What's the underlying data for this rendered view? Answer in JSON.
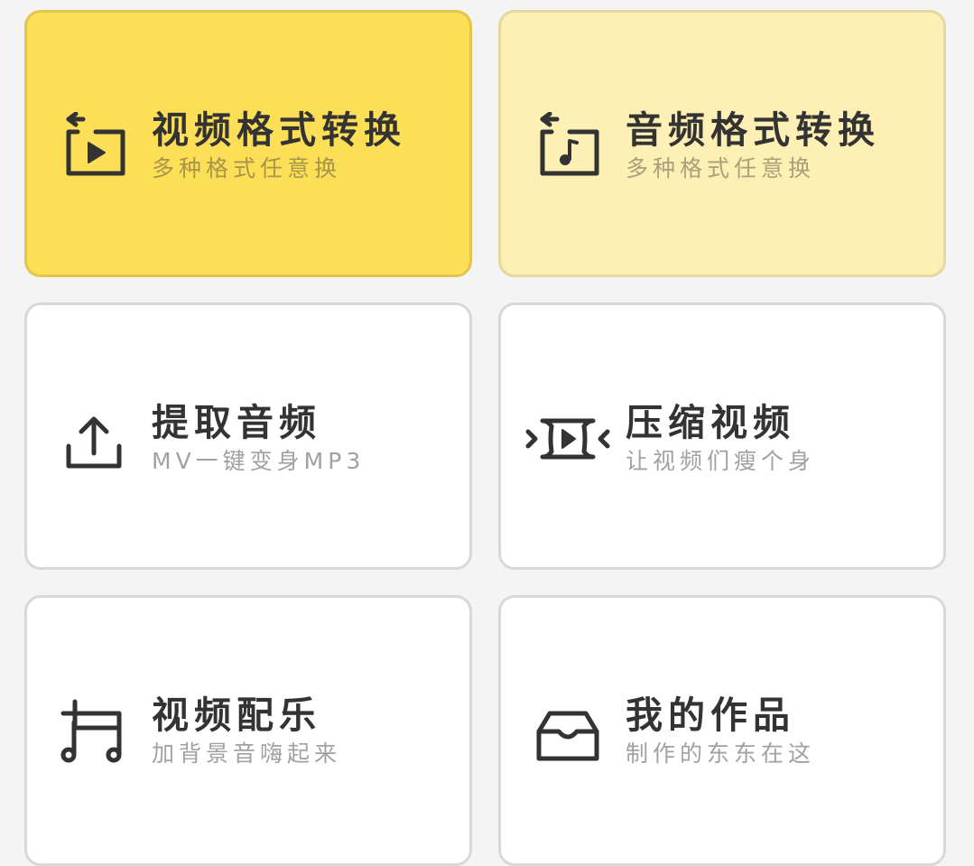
{
  "colors": {
    "background": "#f4f4f4",
    "primary_card": "#fddf57",
    "secondary_card": "#feefb4",
    "card": "#ffffff",
    "text": "#333333",
    "subtext": "#a1a1a1"
  },
  "cards": [
    {
      "icon": "video-convert-icon",
      "title": "视频格式转换",
      "subtitle": "多种格式任意换"
    },
    {
      "icon": "audio-convert-icon",
      "title": "音频格式转换",
      "subtitle": "多种格式任意换"
    },
    {
      "icon": "upload-icon",
      "title": "提取音频",
      "subtitle": "MV一键变身MP3"
    },
    {
      "icon": "compress-video-icon",
      "title": "压缩视频",
      "subtitle": "让视频们瘦个身"
    },
    {
      "icon": "music-add-icon",
      "title": "视频配乐",
      "subtitle": "加背景音嗨起来"
    },
    {
      "icon": "inbox-icon",
      "title": "我的作品",
      "subtitle": "制作的东东在这"
    }
  ]
}
